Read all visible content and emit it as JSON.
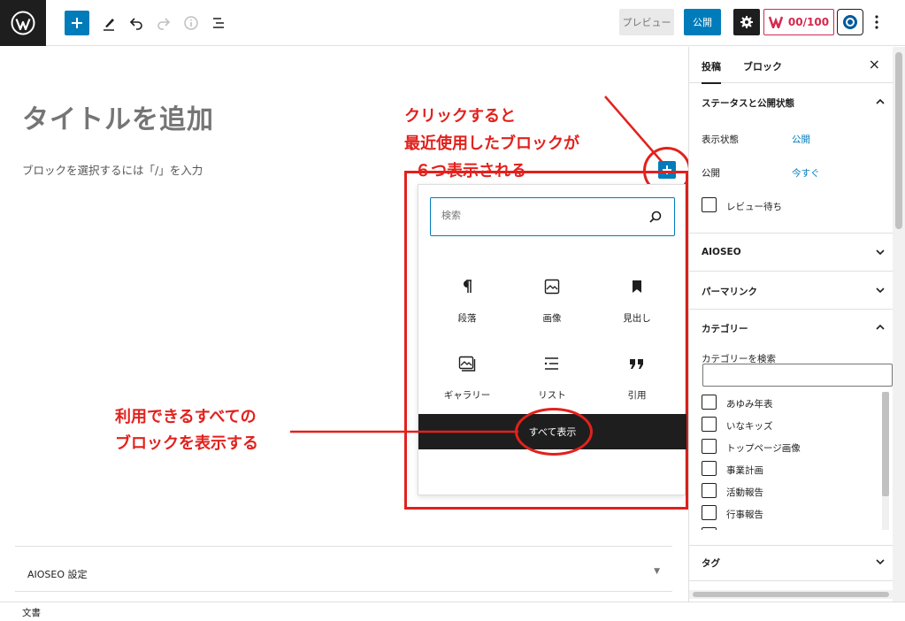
{
  "toolbar": {
    "preview_label": "プレビュー",
    "publish_label": "公開",
    "score_label": "00/100",
    "icons": {
      "logo": "wordpress-logo",
      "inserter": "plus-icon",
      "tools": "pencil-icon",
      "undo": "undo-icon",
      "redo": "redo-icon",
      "details": "info-icon",
      "outline": "list-view-icon",
      "settings": "gear-icon",
      "seo": "seo-plugin-icon",
      "plugin": "plugin-badge-icon",
      "more": "more-vertical-icon"
    }
  },
  "editor": {
    "title_placeholder": "タイトルを追加",
    "block_hint": "ブロックを選択するには「/」を入力"
  },
  "annotations": {
    "top_line1": "クリックすると",
    "top_line2": "最近使用したブロックが",
    "top_line3": "６つ表示される",
    "bottom_line1": "利用できるすべての",
    "bottom_line2": "ブロックを表示する",
    "color": "#e2211c"
  },
  "inserter": {
    "search_placeholder": "検索",
    "blocks": [
      {
        "label": "段落",
        "icon": "paragraph-icon"
      },
      {
        "label": "画像",
        "icon": "image-icon"
      },
      {
        "label": "見出し",
        "icon": "heading-icon"
      },
      {
        "label": "ギャラリー",
        "icon": "gallery-icon"
      },
      {
        "label": "リスト",
        "icon": "list-icon"
      },
      {
        "label": "引用",
        "icon": "quote-icon"
      }
    ],
    "show_all_label": "すべて表示"
  },
  "metabox": {
    "title": "AIOSEO 設定"
  },
  "sidebar": {
    "tabs": [
      "投稿",
      "ブロック"
    ],
    "status_panel": {
      "title": "ステータスと公開状態",
      "visibility_label": "表示状態",
      "visibility_value": "公開",
      "publish_label": "公開",
      "publish_value": "今すぐ",
      "pending_label": "レビュー待ち"
    },
    "panels": {
      "aioseo": "AIOSEO",
      "permalink": "パーマリンク",
      "category": "カテゴリー",
      "tags": "タグ"
    },
    "category_search_label": "カテゴリーを検索",
    "categories": [
      "あゆみ年表",
      "いなキッズ",
      "トップページ画像",
      "事業計画",
      "活動報告",
      "行事報告"
    ]
  },
  "footer": {
    "breadcrumb": "文書"
  },
  "colors": {
    "accent": "#007cba",
    "dark": "#1e1e1e",
    "seo_red": "#d5284d"
  }
}
